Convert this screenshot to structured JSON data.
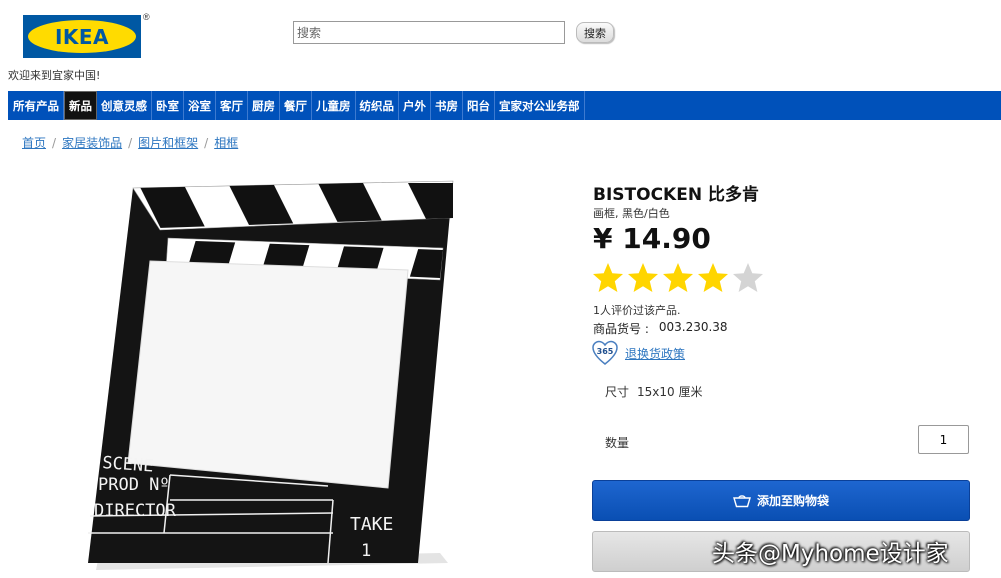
{
  "header": {
    "logo_text": "IKEA",
    "registered_mark": "®",
    "search_placeholder": "搜索",
    "search_button": "搜索",
    "welcome": "欢迎来到宜家中国!"
  },
  "nav": {
    "items": [
      {
        "label": "所有产品",
        "active": false
      },
      {
        "label": "新品",
        "active": true
      },
      {
        "label": "创意灵感",
        "active": false
      },
      {
        "label": "卧室",
        "active": false
      },
      {
        "label": "浴室",
        "active": false
      },
      {
        "label": "客厅",
        "active": false
      },
      {
        "label": "厨房",
        "active": false
      },
      {
        "label": "餐厅",
        "active": false
      },
      {
        "label": "儿童房",
        "active": false
      },
      {
        "label": "纺织品",
        "active": false
      },
      {
        "label": "户外",
        "active": false
      },
      {
        "label": "书房",
        "active": false
      },
      {
        "label": "阳台",
        "active": false
      },
      {
        "label": "宜家对公业务部",
        "active": false
      }
    ]
  },
  "breadcrumb": [
    "首页",
    "家居装饰品",
    "图片和框架",
    "相框"
  ],
  "product": {
    "title": "BISTOCKEN 比多肯",
    "subtitle": "画框, 黑色/白色",
    "price": "¥ 14.90",
    "rating": 4,
    "rating_max": 5,
    "reviews": "1人评价过该产品.",
    "article_label": "商品货号 :",
    "article_number": "003.230.38",
    "return_badge": "365",
    "return_link": "退换货政策",
    "size_label": "尺寸",
    "size_value": "15x10 厘米",
    "quantity_label": "数量",
    "quantity_value": "1",
    "add_to_cart": "添加至购物袋",
    "image_text": {
      "scene": "SCENE",
      "prod": "PROD Nº",
      "director": "DIRECTOR",
      "take": "TAKE",
      "take_number": "1"
    }
  },
  "watermark": "头条@Myhome设计家",
  "colors": {
    "nav_blue": "#0051ba",
    "logo_blue": "#0058a3",
    "logo_yellow": "#ffdb00",
    "star_yellow": "#ffd500",
    "link_blue": "#2d76c0",
    "button_blue": "#0a4fb3"
  }
}
